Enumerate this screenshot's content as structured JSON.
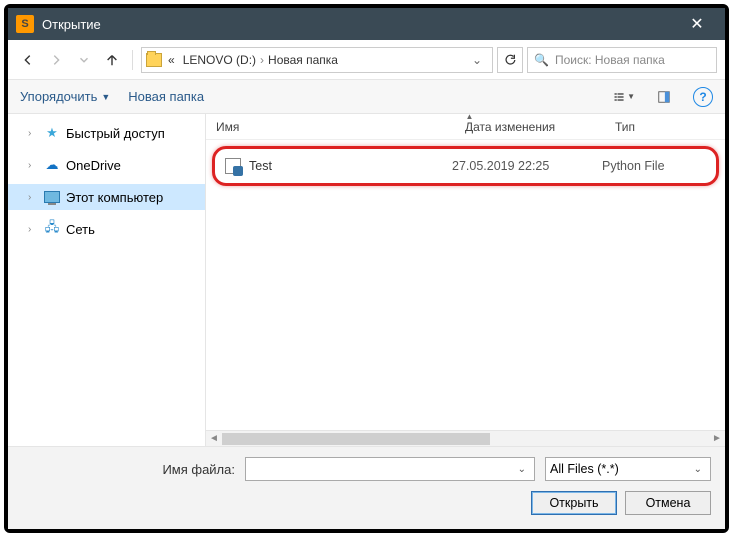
{
  "window": {
    "title": "Открытие"
  },
  "breadcrumb": {
    "root_marker": "«",
    "parts": [
      "LENOVO (D:)",
      "Новая папка"
    ]
  },
  "search": {
    "placeholder": "Поиск: Новая папка"
  },
  "toolbar": {
    "organize": "Упорядочить",
    "new_folder": "Новая папка"
  },
  "sidebar": {
    "quick_access": "Быстрый доступ",
    "onedrive": "OneDrive",
    "this_pc": "Этот компьютер",
    "network": "Сеть"
  },
  "columns": {
    "name": "Имя",
    "date": "Дата изменения",
    "type": "Тип"
  },
  "files": [
    {
      "name": "Test",
      "date": "27.05.2019 22:25",
      "type": "Python File"
    }
  ],
  "footer": {
    "filename_label": "Имя файла:",
    "filename_value": "",
    "filter": "All Files (*.*)",
    "open": "Открыть",
    "cancel": "Отмена"
  }
}
